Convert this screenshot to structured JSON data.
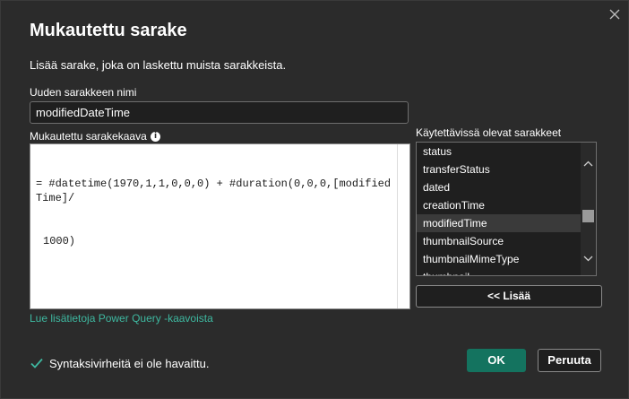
{
  "dialog": {
    "title": "Mukautettu sarake",
    "subtitle": "Lisää sarake, joka on laskettu muista sarakkeista."
  },
  "column_name": {
    "label": "Uuden sarakkeen nimi",
    "value": "modifiedDateTime"
  },
  "formula": {
    "label": "Mukautettu sarakekaava",
    "info_icon_glyph": "i",
    "line1": "= #datetime(1970,1,1,0,0,0) + #duration(0,0,0,[modifiedTime]/",
    "line2": "1000)"
  },
  "available_columns": {
    "label": "Käytettävissä olevat sarakkeet",
    "items": [
      "status",
      "transferStatus",
      "dated",
      "creationTime",
      "modifiedTime",
      "thumbnailSource",
      "thumbnailMimeType",
      "thumbnail"
    ],
    "selected": "modifiedTime"
  },
  "add_button": {
    "label": "<< Lisää"
  },
  "learn_more_link": {
    "label": "Lue lisätietoja Power Query -kaavoista"
  },
  "status": {
    "text": "Syntaksivirheitä ei ole havaittu.",
    "color": "#3eb8a0"
  },
  "buttons": {
    "ok": "OK",
    "cancel": "Peruuta"
  },
  "colors": {
    "background": "#2b2b2b",
    "accent": "#14735f",
    "link": "#3eb8a0"
  },
  "icons": {
    "close": "close-icon",
    "check": "check-icon",
    "info": "info-icon",
    "scroll_up": "chevron-up-icon",
    "scroll_down": "chevron-down-icon"
  }
}
